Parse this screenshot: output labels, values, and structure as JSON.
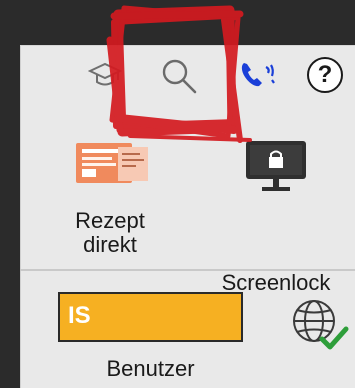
{
  "toolbar": {
    "icons": [
      {
        "name": "graduation-cap-icon"
      },
      {
        "name": "search-icon"
      },
      {
        "name": "phone-icon",
        "color": "#1a3fd8"
      },
      {
        "name": "help-icon",
        "glyph": "?"
      }
    ]
  },
  "actions": {
    "rezept": {
      "line1": "Rezept",
      "line2": "direkt",
      "color": "#f08a5d"
    },
    "screenlock": {
      "label": "Screenlock"
    }
  },
  "user": {
    "badge_text": "IS",
    "badge_color": "#f6b022",
    "label": "Benutzer"
  },
  "annotation": {
    "color": "#d41a20"
  }
}
